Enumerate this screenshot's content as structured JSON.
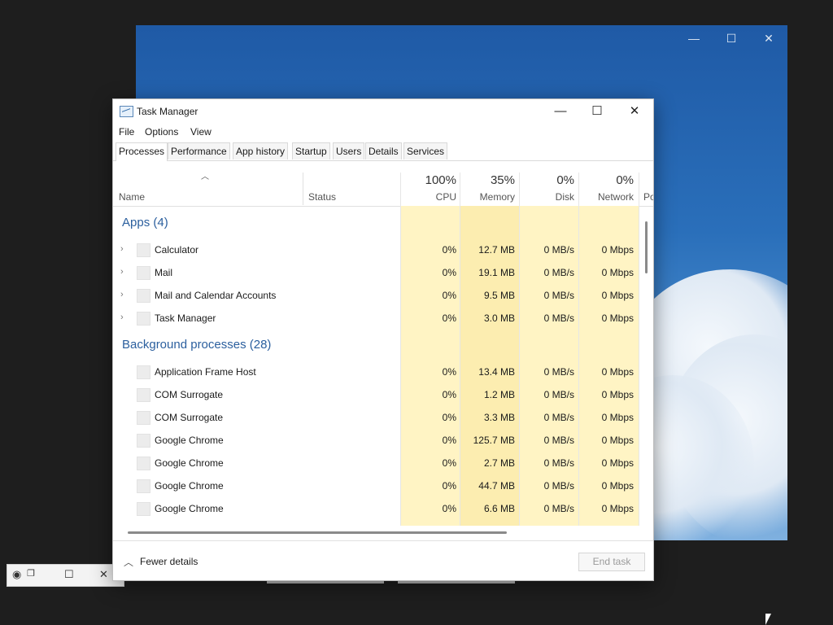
{
  "window": {
    "title": "Task Manager",
    "controls": {
      "minimize": "—",
      "maximize": "☐",
      "close": "✕"
    }
  },
  "menu": [
    "File",
    "Options",
    "View"
  ],
  "tabs": [
    "Processes",
    "Performance",
    "App history",
    "Startup",
    "Users",
    "Details",
    "Services"
  ],
  "active_tab": "Processes",
  "columns": {
    "name": "Name",
    "status": "Status",
    "cpu": {
      "pct": "100%",
      "label": "CPU"
    },
    "memory": {
      "pct": "35%",
      "label": "Memory"
    },
    "disk": {
      "pct": "0%",
      "label": "Disk"
    },
    "network": {
      "pct": "0%",
      "label": "Network"
    },
    "truncated": "Po"
  },
  "groups": {
    "apps": "Apps (4)",
    "background": "Background processes (28)"
  },
  "apps": [
    {
      "name": "Calculator",
      "cpu": "0%",
      "memory": "12.7 MB",
      "disk": "0 MB/s",
      "network": "0 Mbps"
    },
    {
      "name": "Mail",
      "cpu": "0%",
      "memory": "19.1 MB",
      "disk": "0 MB/s",
      "network": "0 Mbps"
    },
    {
      "name": "Mail and Calendar Accounts",
      "cpu": "0%",
      "memory": "9.5 MB",
      "disk": "0 MB/s",
      "network": "0 Mbps"
    },
    {
      "name": "Task Manager",
      "cpu": "0%",
      "memory": "3.0 MB",
      "disk": "0 MB/s",
      "network": "0 Mbps"
    }
  ],
  "background": [
    {
      "name": "Application Frame Host",
      "cpu": "0%",
      "memory": "13.4 MB",
      "disk": "0 MB/s",
      "network": "0 Mbps"
    },
    {
      "name": "COM Surrogate",
      "cpu": "0%",
      "memory": "1.2 MB",
      "disk": "0 MB/s",
      "network": "0 Mbps"
    },
    {
      "name": "COM Surrogate",
      "cpu": "0%",
      "memory": "3.3 MB",
      "disk": "0 MB/s",
      "network": "0 Mbps"
    },
    {
      "name": "Google Chrome",
      "cpu": "0%",
      "memory": "125.7 MB",
      "disk": "0 MB/s",
      "network": "0 Mbps"
    },
    {
      "name": "Google Chrome",
      "cpu": "0%",
      "memory": "2.7 MB",
      "disk": "0 MB/s",
      "network": "0 Mbps"
    },
    {
      "name": "Google Chrome",
      "cpu": "0%",
      "memory": "44.7 MB",
      "disk": "0 MB/s",
      "network": "0 Mbps"
    },
    {
      "name": "Google Chrome",
      "cpu": "0%",
      "memory": "6.6 MB",
      "disk": "0 MB/s",
      "network": "0 Mbps"
    }
  ],
  "footer": {
    "fewer_details": "Fewer details",
    "end_task": "End task"
  },
  "bg_window_controls": {
    "minimize": "—",
    "maximize": "☐",
    "close": "✕"
  },
  "colors": {
    "group_heading": "#2b5f9e",
    "heat_cpu": "#fff4c4",
    "heat_memory": "#fcedb0",
    "desktop_window": "#2a6fba"
  }
}
